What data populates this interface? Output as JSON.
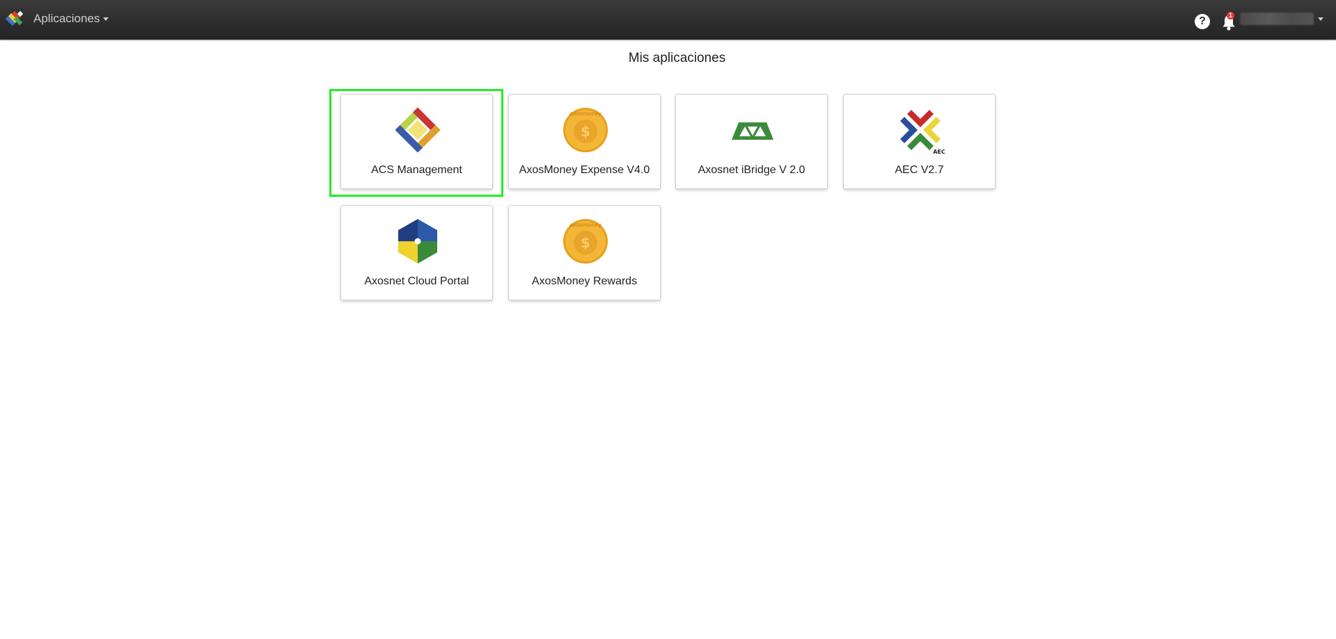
{
  "header": {
    "apps_menu_label": "Aplicaciones",
    "notification_count": "1",
    "help_symbol": "?"
  },
  "main": {
    "title": "Mis aplicaciones",
    "apps": [
      {
        "label": "ACS Management",
        "icon": "acs-diamond-icon"
      },
      {
        "label": "AxosMoney Expense V4.0",
        "icon": "axosmoney-coin-icon"
      },
      {
        "label": "Axosnet iBridge V 2.0",
        "icon": "ibridge-icon"
      },
      {
        "label": "AEC V2.7",
        "icon": "aec-cross-icon"
      },
      {
        "label": "Axosnet Cloud Portal",
        "icon": "cloud-portal-cube-icon"
      },
      {
        "label": "AxosMoney Rewards",
        "icon": "axosmoney-coin-icon"
      }
    ],
    "coin_text": "axosmoney",
    "coin_symbol": "$",
    "aec_text": "AEC"
  },
  "colors": {
    "topbar": "#2b2b2b",
    "highlight": "#22ee22",
    "card_border": "#cfcfcf",
    "coin_gold": "#f2b233",
    "ibridge_green": "#3c8a3c",
    "badge_red": "#e53935"
  }
}
